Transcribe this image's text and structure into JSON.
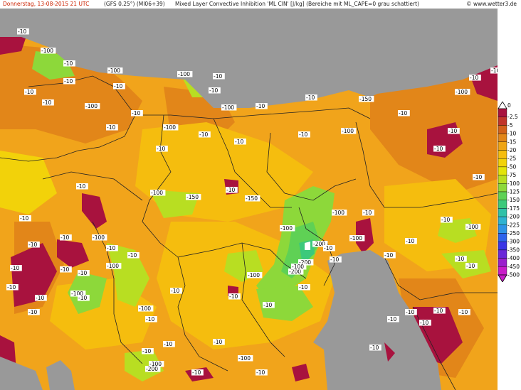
{
  "header": {
    "date": "Donnerstag, 13-08-2015   21 UTC",
    "model": "(GFS 0.25°) (MI06+39)",
    "title": "Mixed Layer Convective Inhibition 'ML CIN' [J/kg] (Bereiche mit ML_CAPE=0 grau schattiert)",
    "brand": "© www.wetter3.de"
  },
  "legend": {
    "top_label": "0",
    "levels": [
      {
        "label": "-2.5",
        "color": "#a8123e"
      },
      {
        "label": "-5",
        "color": "#c0352a"
      },
      {
        "label": "-10",
        "color": "#d2611a"
      },
      {
        "label": "-15",
        "color": "#e28619"
      },
      {
        "label": "-20",
        "color": "#efa514"
      },
      {
        "label": "-25",
        "color": "#f5bd0e"
      },
      {
        "label": "-50",
        "color": "#f2d20a"
      },
      {
        "label": "-75",
        "color": "#e3e40b"
      },
      {
        "label": "-100",
        "color": "#b8de22"
      },
      {
        "label": "-125",
        "color": "#8dd83a"
      },
      {
        "label": "-150",
        "color": "#5fd155"
      },
      {
        "label": "-175",
        "color": "#3cc97b"
      },
      {
        "label": "-200",
        "color": "#30c1a8"
      },
      {
        "label": "-225",
        "color": "#2fb2d1"
      },
      {
        "label": "-250",
        "color": "#2e93e6"
      },
      {
        "label": "-300",
        "color": "#2d63ec"
      },
      {
        "label": "-350",
        "color": "#3a35e6"
      },
      {
        "label": "-400",
        "color": "#6a28d8"
      },
      {
        "label": "-450",
        "color": "#9a20cc"
      },
      {
        "label": "-500",
        "color": "#c81cc8"
      }
    ]
  },
  "colors": {
    "no_cape_gray": "#999999",
    "border_line": "#222222",
    "field_orange": "#f1a41b"
  },
  "contour_labels": {
    "items": [
      "-10",
      "-100",
      "-10",
      "-100",
      "-10",
      "-100",
      "-10",
      "-100",
      "-10",
      "-10",
      "-10",
      "-150",
      "-10",
      "-10",
      "-10",
      "-100",
      "-10",
      "-10",
      "-100",
      "-10",
      "-10",
      "-10",
      "-10",
      "-100",
      "-10",
      "-100",
      "-10",
      "-100",
      "-10",
      "-10",
      "-10",
      "-100",
      "-150",
      "-150",
      "-10",
      "-100",
      "-10",
      "-10",
      "-100",
      "-10",
      "-10",
      "-200",
      "-10",
      "-100",
      "-200",
      "-10",
      "-100",
      "-10",
      "-10",
      "-10",
      "-10",
      "-100",
      "-10",
      "-10",
      "-10",
      "-10",
      "-10",
      "-10",
      "-10",
      "-10",
      "-100",
      "-10",
      "-10",
      "-100",
      "-10",
      "-10",
      "-100",
      "-10",
      "-10",
      "-10",
      "-10",
      "-10",
      "-10",
      "-10",
      "-10",
      "-10",
      "-10",
      "-100",
      "-10",
      "-10",
      "-100",
      "-10",
      "-10",
      "-200",
      "-200",
      "-100",
      "-10",
      "-100"
    ]
  }
}
